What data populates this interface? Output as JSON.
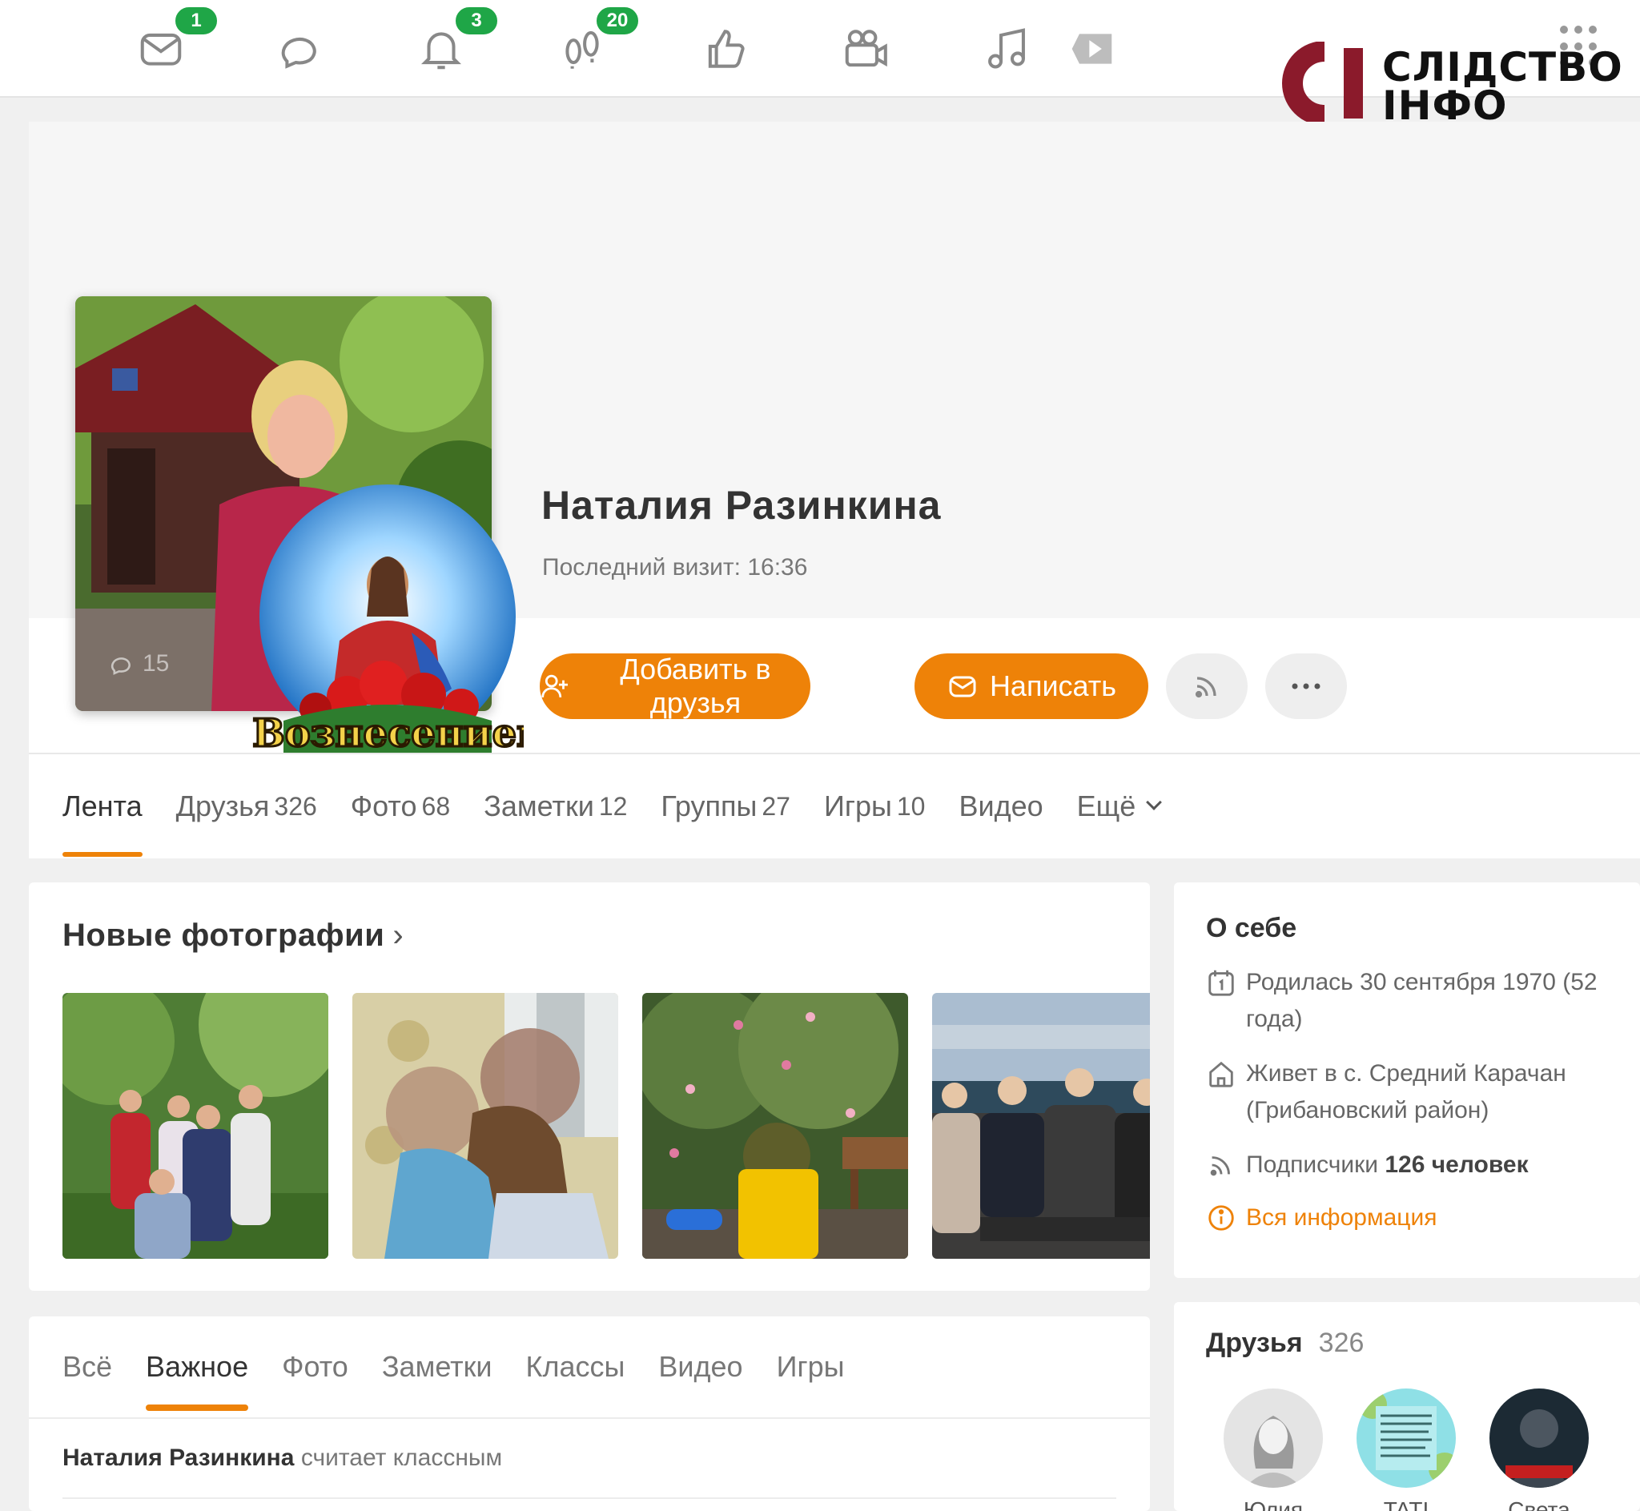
{
  "topbar": {
    "icons": [
      {
        "name": "messages-icon",
        "badge": "1"
      },
      {
        "name": "discussions-icon",
        "badge": ""
      },
      {
        "name": "notifications-icon",
        "badge": "3"
      },
      {
        "name": "guests-icon",
        "badge": "20"
      },
      {
        "name": "likes-icon",
        "badge": ""
      },
      {
        "name": "friends-video-icon",
        "badge": ""
      },
      {
        "name": "music-icon",
        "badge": ""
      },
      {
        "name": "video-icon",
        "badge": ""
      }
    ]
  },
  "watermark": {
    "line1": "СЛІДСТВО",
    "line2": "ІНФО",
    "mark_color": "#8b1a2b"
  },
  "profile": {
    "name": "Наталия Разинкина",
    "last_visit": "Последний визит: 16:36",
    "avatar_comments": "15",
    "avatar_sticker_text": "С Вознесением!"
  },
  "actions": {
    "add_friend": "Добавить в друзья",
    "write": "Написать",
    "subscribe_icon": "rss-icon",
    "more_icon": "more-icon"
  },
  "tabs": [
    {
      "label": "Лента",
      "count": ""
    },
    {
      "label": "Друзья",
      "count": "326"
    },
    {
      "label": "Фото",
      "count": "68"
    },
    {
      "label": "Заметки",
      "count": "12"
    },
    {
      "label": "Группы",
      "count": "27"
    },
    {
      "label": "Игры",
      "count": "10"
    },
    {
      "label": "Видео",
      "count": ""
    },
    {
      "label": "Ещё",
      "count": ""
    }
  ],
  "photos": {
    "title": "Новые фотографии",
    "arrow": "›"
  },
  "feed": {
    "tabs": [
      "Всё",
      "Важное",
      "Фото",
      "Заметки",
      "Классы",
      "Видео",
      "Игры"
    ],
    "active_tab": "Важное",
    "entry_author": "Наталия Разинкина",
    "entry_action": "считает классным"
  },
  "about": {
    "title": "О себе",
    "born": "Родилась 30 сентября 1970 (52 года)",
    "lives": "Живет в с. Средний Карачан (Грибановский район)",
    "subscribers_label": "Подписчики",
    "subscribers_value": "126 человек",
    "all_info": "Вся информация"
  },
  "friends": {
    "title": "Друзья",
    "count": "326",
    "items": [
      {
        "name": "Юлия"
      },
      {
        "name": "TATI"
      },
      {
        "name": "Света"
      }
    ]
  },
  "colors": {
    "accent": "#ee8208",
    "badge": "#1fa647"
  }
}
